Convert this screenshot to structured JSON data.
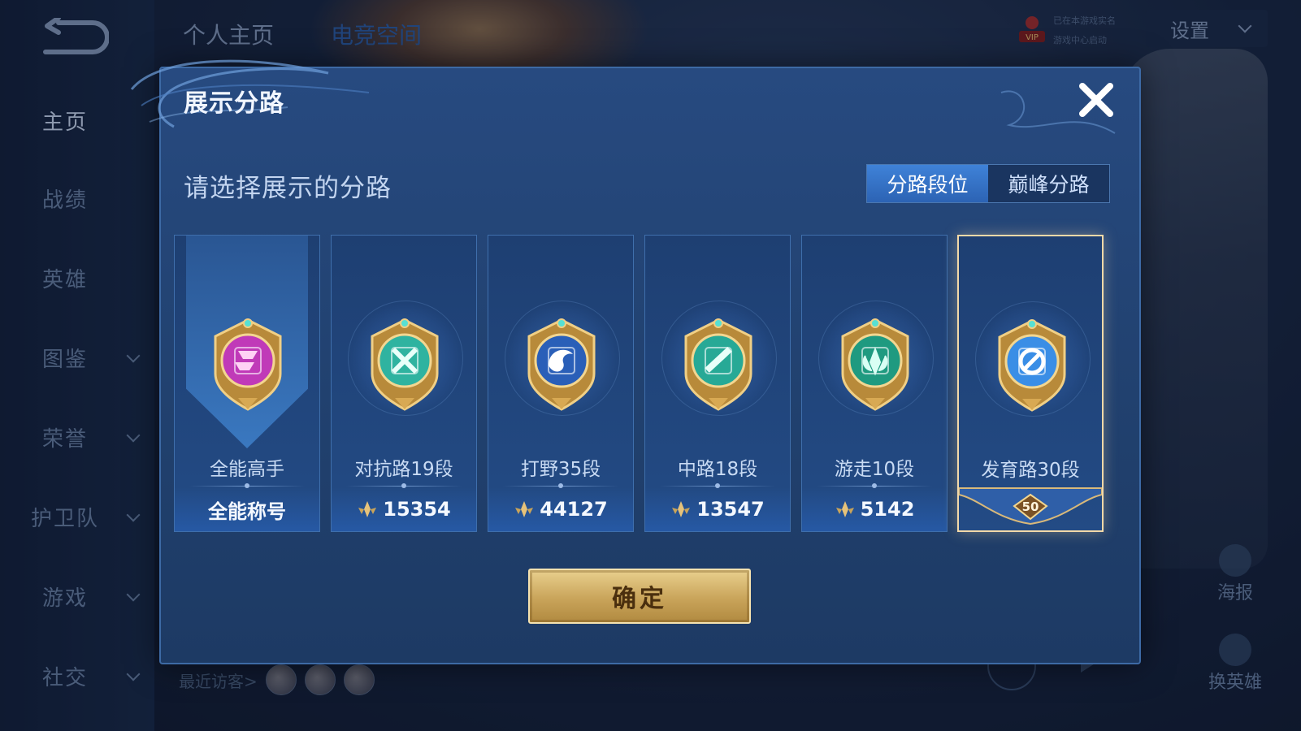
{
  "sidebar": {
    "back_icon": "back-arrow-icon",
    "items": [
      {
        "label": "主页",
        "has_dropdown": false,
        "active": true
      },
      {
        "label": "战绩",
        "has_dropdown": false
      },
      {
        "label": "英雄",
        "has_dropdown": false
      },
      {
        "label": "图鉴",
        "has_dropdown": true
      },
      {
        "label": "荣誉",
        "has_dropdown": true
      },
      {
        "label": "护卫队",
        "has_dropdown": true
      },
      {
        "label": "游戏",
        "has_dropdown": true
      },
      {
        "label": "社交",
        "has_dropdown": true
      }
    ]
  },
  "header": {
    "tabs": [
      {
        "label": "个人主页"
      },
      {
        "label": "电竞空间",
        "selected": true
      }
    ],
    "vip_badge": "VIP",
    "vip_lines": [
      "已在本游戏实名",
      "游戏中心启动"
    ],
    "settings_label": "设置"
  },
  "right_panel": {
    "poster_label": "海报",
    "swap_hero_label": "换英雄"
  },
  "footer": {
    "recent_visitors_label": "最近访客>",
    "visitor_count_shown": 3
  },
  "modal": {
    "title": "展示分路",
    "subtitle": "请选择展示的分路",
    "segments": [
      {
        "label": "分路段位",
        "active": true
      },
      {
        "label": "巅峰分路",
        "active": false
      }
    ],
    "cards": [
      {
        "name": "全能高手",
        "footer": "全能称号",
        "badge": "all-round-master-badge-icon",
        "badge_color": "#c03ab8",
        "selected": false
      },
      {
        "name": "对抗路19段",
        "score": "15354",
        "badge": "clash-lane-badge-icon",
        "badge_color": "#2fb3a0",
        "selected": false
      },
      {
        "name": "打野35段",
        "score": "44127",
        "badge": "jungle-badge-icon",
        "badge_color": "#2a5fb8",
        "selected": false
      },
      {
        "name": "中路18段",
        "score": "13547",
        "badge": "mid-lane-badge-icon",
        "badge_color": "#27a996",
        "selected": false
      },
      {
        "name": "游走10段",
        "score": "5142",
        "badge": "roam-badge-icon",
        "badge_color": "#1f9a80",
        "selected": false
      },
      {
        "name": "发育路30段",
        "level": "50",
        "badge": "farm-lane-badge-icon",
        "badge_color": "#3a8ee6",
        "selected": true
      }
    ],
    "confirm_label": "确定"
  },
  "colors": {
    "modal_bg": "#21416f",
    "accent_blue": "#3f82d8",
    "gold": "#e9d08e",
    "selected_border": "#f3d9a8"
  }
}
